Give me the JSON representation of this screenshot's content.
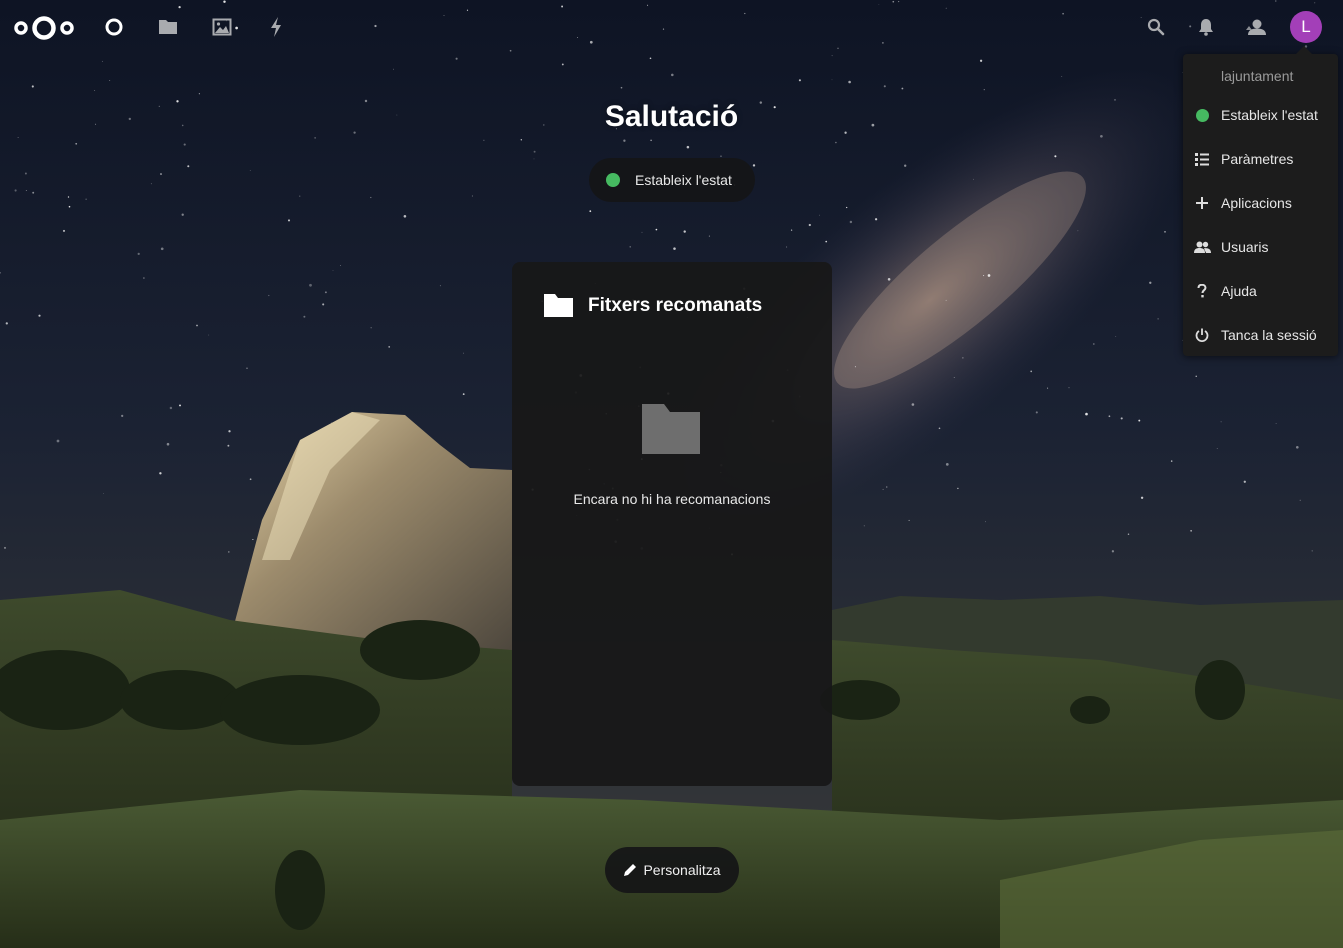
{
  "header": {
    "apps": [
      {
        "name": "dashboard-icon"
      },
      {
        "name": "files-icon"
      },
      {
        "name": "photos-icon"
      },
      {
        "name": "activity-icon"
      }
    ],
    "right_icons": [
      "search-icon",
      "notifications-icon",
      "contacts-icon"
    ],
    "avatar_initial": "L",
    "avatar_color": "#a33fb8"
  },
  "main": {
    "greeting": "Salutació",
    "status_button": "Estableix l'estat",
    "status_color": "#46ba61",
    "panel": {
      "title": "Fitxers recomanats",
      "empty_text": "Encara no hi ha recomanacions"
    },
    "customize_button": "Personalitza"
  },
  "menu": {
    "username": "lajuntament",
    "items": [
      {
        "label": "Estableix l'estat",
        "icon": "status-dot-icon"
      },
      {
        "label": "Paràmetres",
        "icon": "settings-list-icon"
      },
      {
        "label": "Aplicacions",
        "icon": "plus-icon"
      },
      {
        "label": "Usuaris",
        "icon": "users-icon"
      },
      {
        "label": "Ajuda",
        "icon": "help-icon"
      },
      {
        "label": "Tanca la sessió",
        "icon": "power-icon"
      }
    ]
  }
}
